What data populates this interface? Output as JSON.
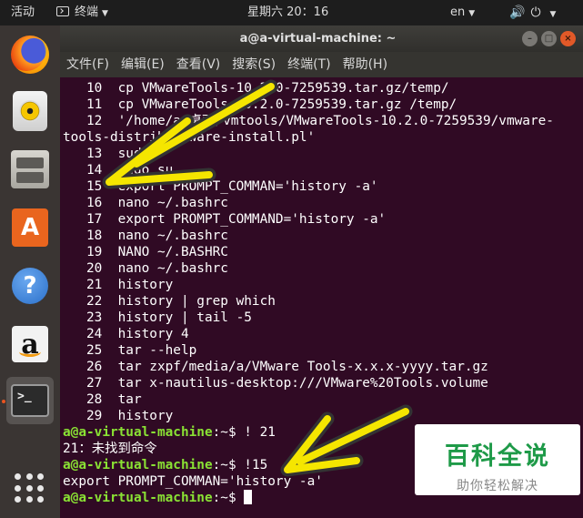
{
  "top_panel": {
    "activities": "活动",
    "app_name": "终端",
    "clock": "星期六 20：16",
    "language": "en",
    "icons": [
      "volume-icon",
      "power-icon",
      "chevron-down-icon"
    ]
  },
  "dock": {
    "items": [
      {
        "name": "firefox-icon"
      },
      {
        "name": "rhythmbox-icon"
      },
      {
        "name": "files-icon"
      },
      {
        "name": "software-center-icon",
        "glyph": "A"
      },
      {
        "name": "help-icon",
        "glyph": "?"
      },
      {
        "name": "amazon-icon",
        "glyph": "a"
      },
      {
        "name": "terminal-icon",
        "glyph": ">_",
        "active": true
      },
      {
        "name": "show-applications-icon"
      }
    ]
  },
  "window": {
    "title": "a@a-virtual-machine: ~",
    "menu": [
      "文件(F)",
      "编辑(E)",
      "查看(V)",
      "搜索(S)",
      "终端(T)",
      "帮助(H)"
    ]
  },
  "terminal": {
    "lines": [
      "   10  cp VMwareTools-10.2.0-7259539.tar.gz/temp/",
      "   11  cp VMwareTools-10.2.0-7259539.tar.gz /temp/",
      "   12  '/home/a/桌面/vmtools/VMwareTools-10.2.0-7259539/vmware-",
      "tools-distrib/vmware-install.pl'",
      "   13  sudo",
      "   14  sudo su",
      "   15  export PROMPT_COMMAN='history -a'",
      "   16  nano ~/.bashrc",
      "   17  export PROMPT_COMMAND='history -a'",
      "   18  nano ~/.bashrc",
      "   19  NANO ~/.BASHRC",
      "   20  nano ~/.bashrc",
      "   21  history",
      "   22  history | grep which",
      "   23  history | tail -5",
      "   24  history 4",
      "   25  tar --help",
      "   26  tar zxpf/media/a/VMware Tools-x.x.x-yyyy.tar.gz",
      "   27  tar x-nautilus-desktop:///VMware%20Tools.volume",
      "   28  tar",
      "   29  history"
    ],
    "prompt": "a@a-virtual-machine",
    "prompt_suffix": ":~$ ",
    "cmd1": "! 21",
    "out1": "21：未找到命令",
    "cmd2": "!15",
    "out2": "export PROMPT_COMMAN='history -a'",
    "cmd3": ""
  },
  "watermark": {
    "title": "百科全说",
    "subtitle": "助你轻松解决"
  },
  "colors": {
    "terminal_bg": "#300a24",
    "prompt_green": "#8ae234",
    "arrow_yellow": "#f5e600",
    "accent_orange": "#e95420"
  }
}
